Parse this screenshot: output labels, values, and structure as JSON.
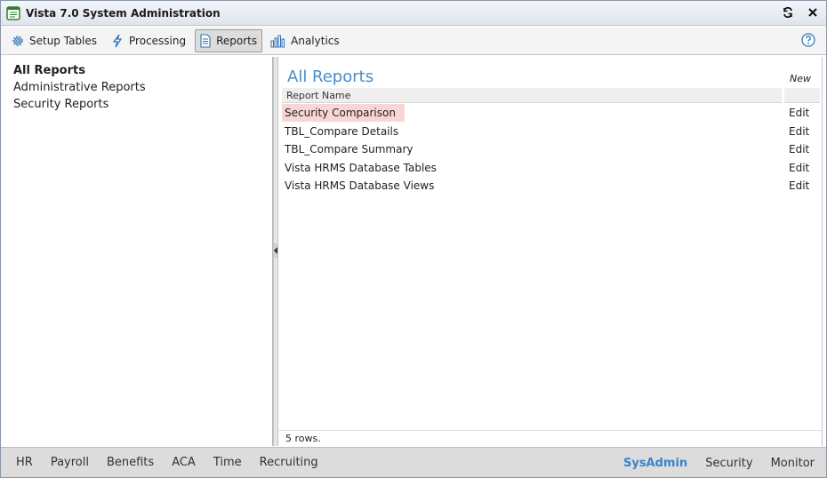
{
  "window": {
    "title": "Vista 7.0 System Administration"
  },
  "toolbar": {
    "buttons": [
      {
        "label": "Setup Tables",
        "icon": "gear-icon"
      },
      {
        "label": "Processing",
        "icon": "lightning-icon"
      },
      {
        "label": "Reports",
        "icon": "document-icon",
        "active": true
      },
      {
        "label": "Analytics",
        "icon": "bar-chart-icon"
      }
    ],
    "help_icon": "help-icon"
  },
  "sidebar": {
    "items": [
      {
        "label": "All Reports",
        "selected": true
      },
      {
        "label": "Administrative Reports"
      },
      {
        "label": "Security Reports"
      }
    ]
  },
  "main": {
    "title": "All Reports",
    "new_label": "New",
    "columns": [
      "Report Name",
      ""
    ],
    "rows": [
      {
        "name": "Security Comparison",
        "action": "Edit",
        "highlighted": true
      },
      {
        "name": "TBL_Compare Details",
        "action": "Edit"
      },
      {
        "name": "TBL_Compare Summary",
        "action": "Edit"
      },
      {
        "name": "Vista HRMS Database Tables",
        "action": "Edit"
      },
      {
        "name": "Vista HRMS Database Views",
        "action": "Edit"
      }
    ],
    "footer": "5 rows."
  },
  "bottom_nav": {
    "left": [
      "HR",
      "Payroll",
      "Benefits",
      "ACA",
      "Time",
      "Recruiting"
    ],
    "right": [
      {
        "label": "SysAdmin",
        "active": true
      },
      {
        "label": "Security"
      },
      {
        "label": "Monitor"
      }
    ]
  },
  "colors": {
    "accent": "#4a8ccb",
    "highlight_row": "#f9d6d6",
    "active_nav": "#3a84c9"
  }
}
